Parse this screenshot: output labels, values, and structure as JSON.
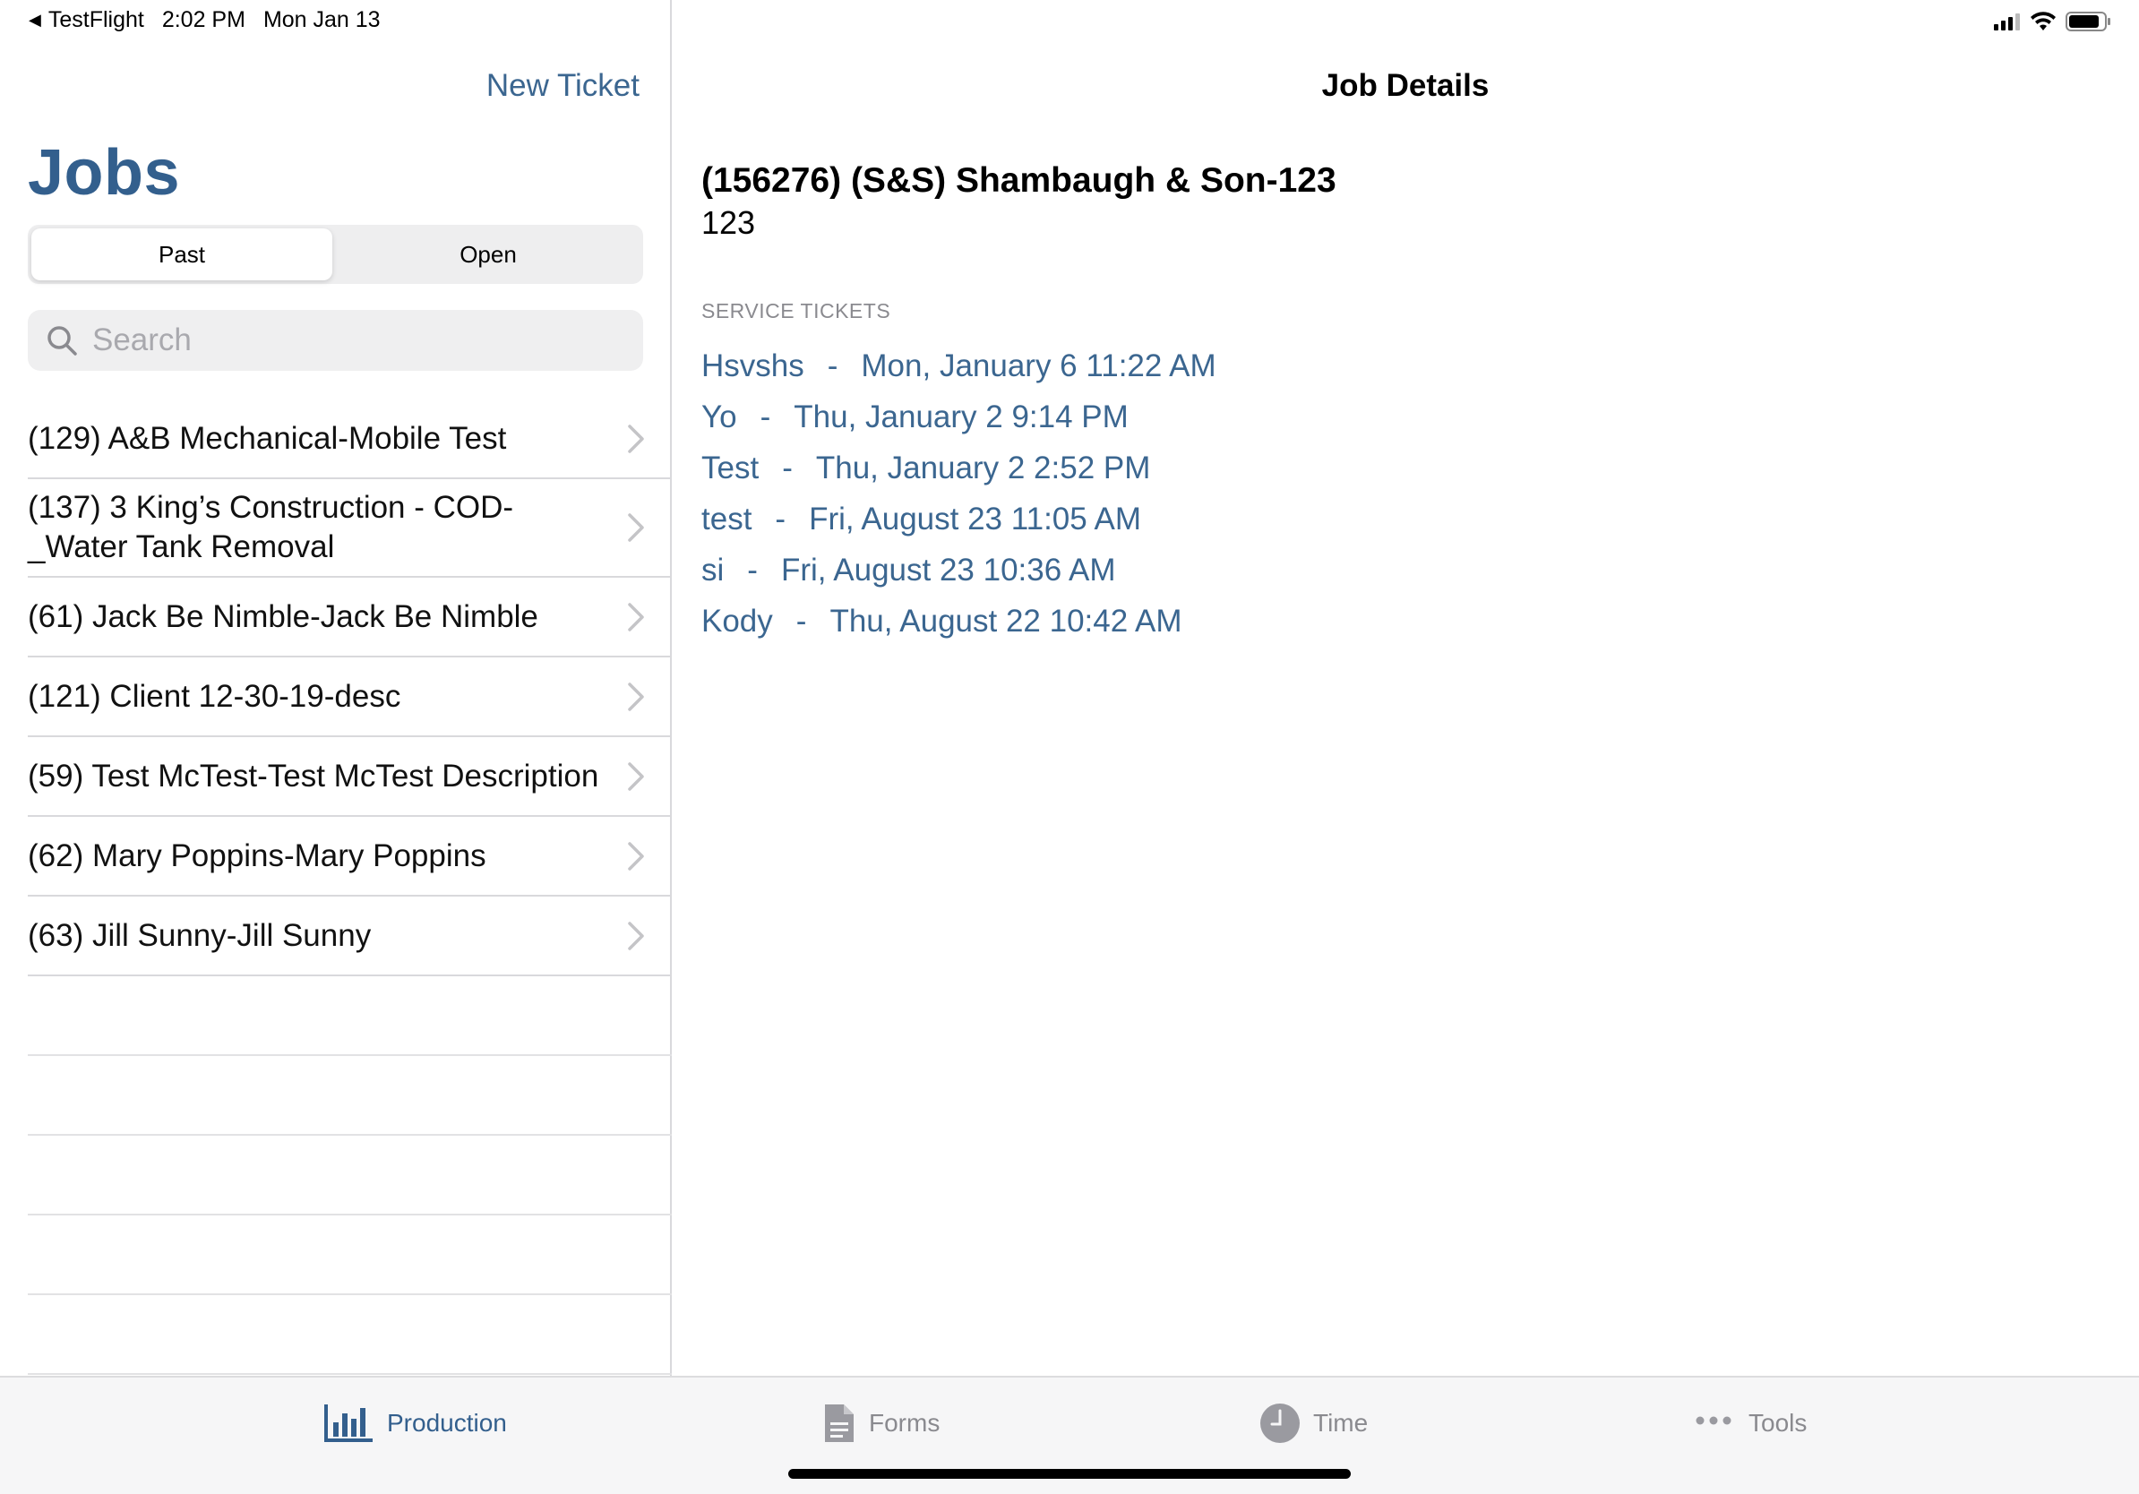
{
  "status_bar": {
    "back_app": "TestFlight",
    "time": "2:02 PM",
    "date": "Mon Jan 13",
    "icons": [
      "cellular-signal-icon",
      "wifi-icon",
      "battery-icon"
    ]
  },
  "master": {
    "new_ticket_label": "New Ticket",
    "title": "Jobs",
    "segments": [
      {
        "label": "Past",
        "selected": true
      },
      {
        "label": "Open",
        "selected": false
      }
    ],
    "search": {
      "placeholder": "Search",
      "value": ""
    },
    "jobs": [
      {
        "label": "(129) A&B Mechanical-Mobile Test"
      },
      {
        "label": "(137) 3 King’s Construction - COD-_Water Tank Removal"
      },
      {
        "label": "(61) Jack Be Nimble-Jack Be Nimble"
      },
      {
        "label": "(121) Client 12-30-19-desc"
      },
      {
        "label": "(59) Test McTest-Test McTest Description"
      },
      {
        "label": "(62) Mary Poppins-Mary Poppins"
      },
      {
        "label": "(63) Jill Sunny-Jill Sunny"
      }
    ]
  },
  "detail": {
    "header": "Job Details",
    "job_name": "(156276) (S&S) Shambaugh & Son-123",
    "job_subtitle": "123",
    "section_label": "SERVICE TICKETS",
    "tickets": [
      {
        "name": "Hsvshs",
        "separator": "-",
        "date": "Mon, January 6 11:22 AM"
      },
      {
        "name": "Yo",
        "separator": "-",
        "date": "Thu, January 2 9:14 PM"
      },
      {
        "name": "Test",
        "separator": "-",
        "date": "Thu, January 2 2:52 PM"
      },
      {
        "name": "test",
        "separator": "-",
        "date": "Fri, August 23 11:05 AM"
      },
      {
        "name": "si",
        "separator": "-",
        "date": "Fri, August 23 10:36 AM"
      },
      {
        "name": "Kody",
        "separator": "-",
        "date": "Thu, August 22 10:42 AM"
      }
    ]
  },
  "tab_bar": {
    "tabs": [
      {
        "label": "Production",
        "icon": "bar-chart-icon",
        "active": true
      },
      {
        "label": "Forms",
        "icon": "document-icon",
        "active": false
      },
      {
        "label": "Time",
        "icon": "clock-icon",
        "active": false
      },
      {
        "label": "Tools",
        "icon": "more-dots-icon",
        "active": false
      }
    ]
  },
  "colors": {
    "accent": "#3b6690",
    "title": "#335f8d",
    "inactive_tab": "#8a8a8f",
    "separator": "#d9d9dc"
  }
}
